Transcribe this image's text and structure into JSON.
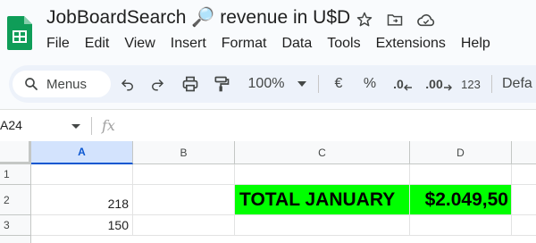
{
  "app": {
    "title": "JobBoardSearch 🔎 revenue in U$D",
    "icons": [
      "star-icon",
      "move-to-folder-icon",
      "cloud-saved-icon"
    ]
  },
  "menu": [
    "File",
    "Edit",
    "View",
    "Insert",
    "Format",
    "Data",
    "Tools",
    "Extensions",
    "Help"
  ],
  "toolbar": {
    "search_label": "Menus",
    "zoom": "100%",
    "currency": "€",
    "percent": "%",
    "decrease_decimals": ".0",
    "increase_decimals": ".00",
    "number_format": "123",
    "font": "Defa"
  },
  "formula_bar": {
    "name_box": "A24",
    "fx": "fx",
    "value": ""
  },
  "grid": {
    "columns": [
      "A",
      "B",
      "C",
      "D"
    ],
    "selected_column": "A",
    "rows": [
      {
        "num": "1",
        "cells": [
          "",
          "",
          "",
          ""
        ]
      },
      {
        "num": "2",
        "cells": [
          "218",
          "",
          "TOTAL JANUARY",
          "$2.049,50"
        ]
      },
      {
        "num": "3",
        "cells": [
          "150",
          "",
          "",
          ""
        ]
      }
    ],
    "highlight_color": "#00ff00"
  },
  "colors": {
    "accent": "#0b57d0",
    "toolbar_bg": "#edf2fa",
    "sheets_green": "#0f9d58"
  }
}
